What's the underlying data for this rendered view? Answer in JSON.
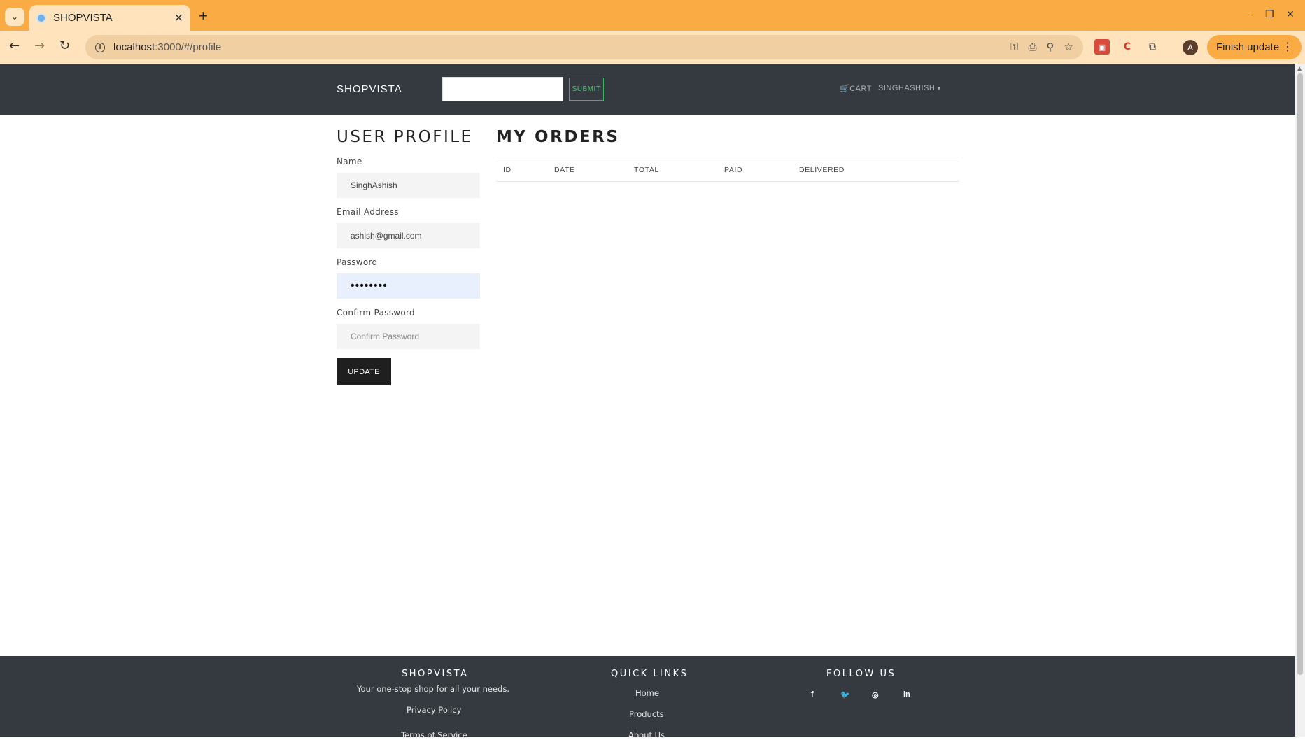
{
  "browser": {
    "tab_title": "SHOPVISTA",
    "new_tab": "+",
    "url_host": "localhost",
    "url_path": ":3000/#/profile",
    "finish_update": "Finish update",
    "avatar_letter": "A",
    "colors": {
      "frame": "#fbab44",
      "toolbar": "#ffe3bd",
      "omnibox": "#f0cfa3"
    }
  },
  "header": {
    "brand": "SHOPVISTA",
    "search_value": "",
    "submit_label": "SUBMIT",
    "cart_label": "CART",
    "user_label": "SINGHASHISH"
  },
  "profile": {
    "title": "USER PROFILE",
    "name_label": "Name",
    "name_value": "SinghAshish",
    "email_label": "Email Address",
    "email_value": "ashish@gmail.com",
    "password_label": "Password",
    "password_value": "••••••••",
    "confirm_label": "Confirm Password",
    "confirm_placeholder": "Confirm Password",
    "update_label": "UPDATE"
  },
  "orders": {
    "title": "MY ORDERS",
    "columns": [
      "ID",
      "DATE",
      "TOTAL",
      "PAID",
      "DELIVERED"
    ],
    "rows": []
  },
  "footer": {
    "brand_title": "SHOPVISTA",
    "tagline": "Your one-stop shop for all your needs.",
    "privacy": "Privacy Policy",
    "terms": "Terms of Service",
    "quick_links_title": "QUICK LINKS",
    "links": [
      "Home",
      "Products",
      "About Us"
    ],
    "follow_title": "FOLLOW US",
    "social": [
      "f",
      "twitter-bird",
      "instagram",
      "in"
    ],
    "colors": {
      "background": "#343a40"
    }
  }
}
